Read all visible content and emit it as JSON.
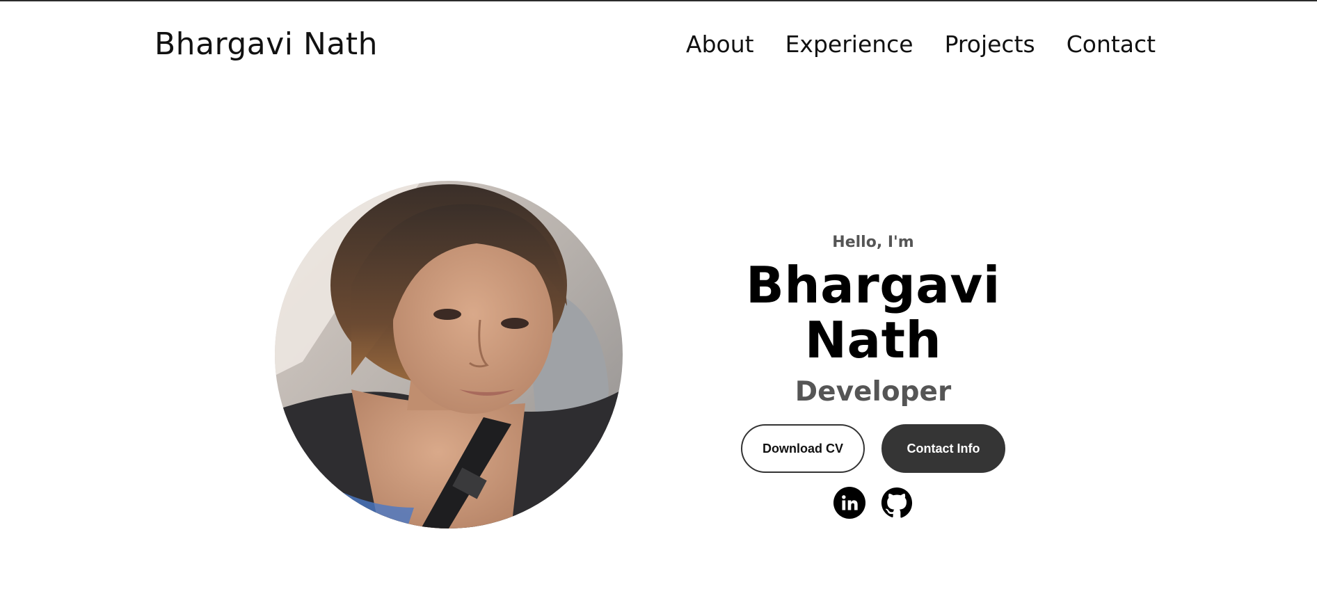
{
  "header": {
    "logo": "Bhargavi Nath",
    "nav": [
      {
        "label": "About"
      },
      {
        "label": "Experience"
      },
      {
        "label": "Projects"
      },
      {
        "label": "Contact"
      }
    ]
  },
  "hero": {
    "greeting": "Hello, I'm",
    "name": "Bhargavi Nath",
    "role": "Developer",
    "buttons": {
      "download_cv": "Download CV",
      "contact_info": "Contact Info"
    },
    "socials": [
      {
        "icon": "linkedin-icon"
      },
      {
        "icon": "github-icon"
      }
    ]
  },
  "colors": {
    "accent_dark": "#353535",
    "subtext": "#555555",
    "text": "#000000"
  }
}
